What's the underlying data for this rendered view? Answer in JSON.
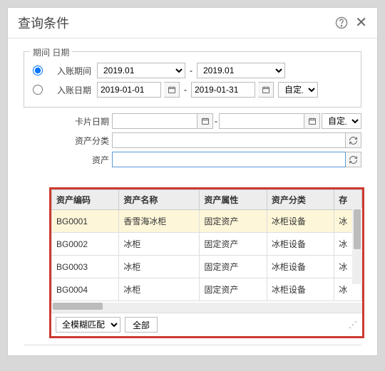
{
  "title": "查询条件",
  "fieldset": {
    "legend": "期间 日期",
    "period_label": "入账期间",
    "period_from": "2019.01",
    "period_to": "2019.01",
    "date_label": "入账日期",
    "date_from": "2019-01-01",
    "date_to": "2019-01-31",
    "custom_sel": "自定义"
  },
  "form": {
    "card_date_label": "卡片日期",
    "card_custom": "自定义",
    "category_label": "资产分类",
    "category_value": "",
    "asset_label": "资产",
    "asset_value": ""
  },
  "table": {
    "headers": [
      "资产编码",
      "资产名称",
      "资产属性",
      "资产分类",
      "存"
    ],
    "rows": [
      [
        "BG0001",
        "香雪海冰柜",
        "固定资产",
        "冰柜设备",
        "冰"
      ],
      [
        "BG0002",
        "冰柜",
        "固定资产",
        "冰柜设备",
        "冰"
      ],
      [
        "BG0003",
        "冰柜",
        "固定资产",
        "冰柜设备",
        "冰"
      ],
      [
        "BG0004",
        "冰柜",
        "固定资产",
        "冰柜设备",
        "冰"
      ]
    ]
  },
  "footer": {
    "match_mode": "全模糊匹配",
    "all_btn": "全部"
  }
}
